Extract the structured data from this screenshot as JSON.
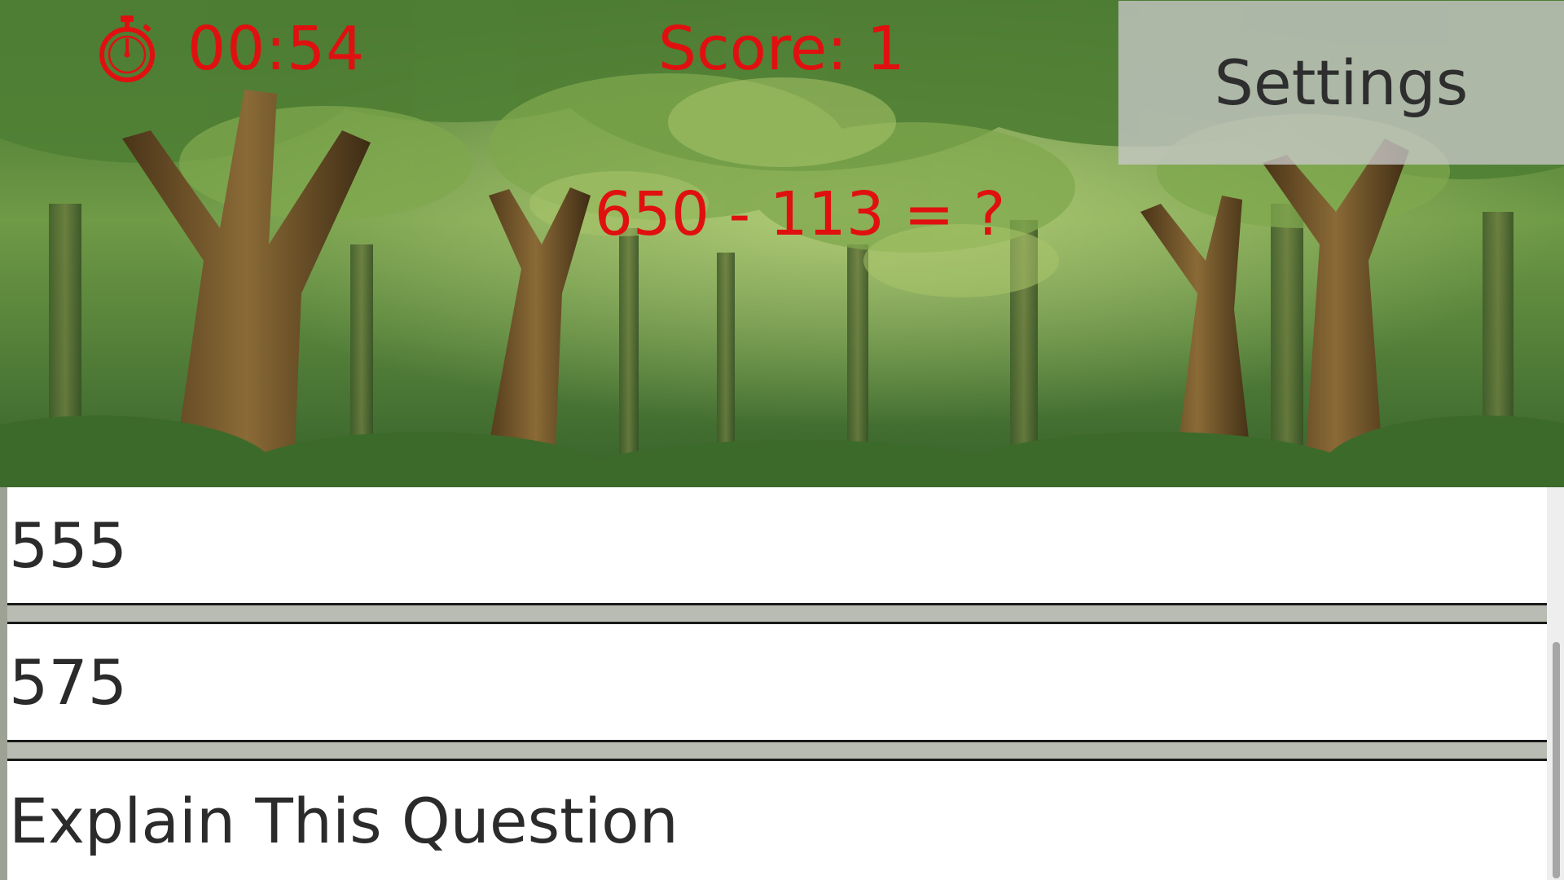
{
  "hud": {
    "timer": "00:54",
    "score": "Score: 1",
    "settings_label": "Settings"
  },
  "question": {
    "text": "650 - 113 = ?"
  },
  "answers": [
    {
      "label": "555"
    },
    {
      "label": "575"
    }
  ],
  "explain_label": "Explain This Question",
  "icons": {
    "timer": "stopwatch-icon"
  },
  "colors": {
    "hud_text": "#e01010",
    "settings_bg": "#c8c8c8",
    "option_bg": "#ffffff",
    "option_text": "#2b2b2b",
    "panel_gap": "#b9bcb2"
  }
}
